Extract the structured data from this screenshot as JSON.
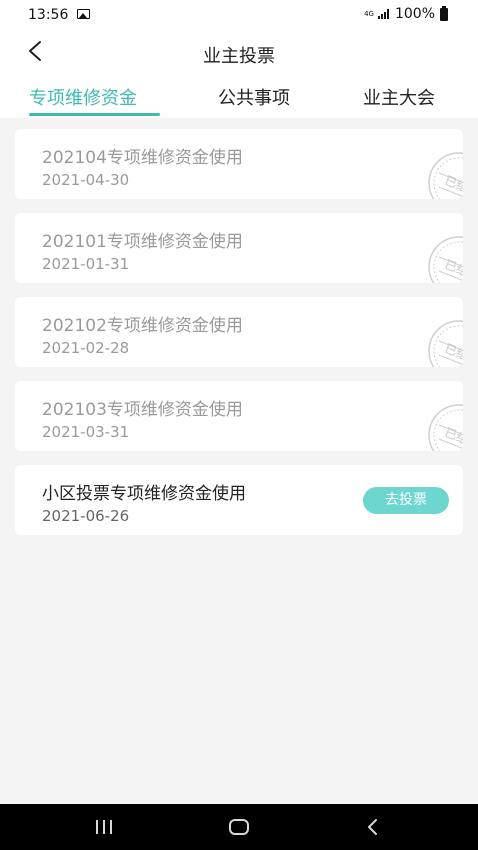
{
  "status_bar": {
    "time": "13:56",
    "network": "4G",
    "battery": "100%"
  },
  "header": {
    "title": "业主投票"
  },
  "tabs": [
    {
      "label": "专项维修资金",
      "active": true
    },
    {
      "label": "公共事项",
      "active": false
    },
    {
      "label": "业主大会",
      "active": false
    }
  ],
  "items": [
    {
      "title": "202104专项维修资金使用",
      "date": "2021-04-30",
      "status": "已结束"
    },
    {
      "title": "202101专项维修资金使用",
      "date": "2021-01-31",
      "status": "已结束"
    },
    {
      "title": "202102专项维修资金使用",
      "date": "2021-02-28",
      "status": "已结束"
    },
    {
      "title": "202103专项维修资金使用",
      "date": "2021-03-31",
      "status": "已结束"
    },
    {
      "title": "小区投票专项维修资金使用",
      "date": "2021-06-26",
      "action": "去投票"
    }
  ],
  "colors": {
    "accent": "#3dbbb2",
    "vote_button": "#6cd6cf"
  }
}
